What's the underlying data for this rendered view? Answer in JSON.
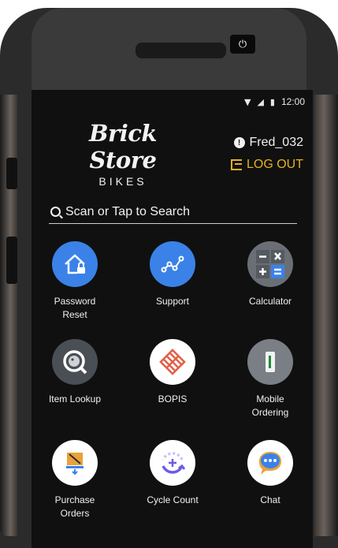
{
  "device": {
    "power_symbol": "⏻"
  },
  "status_bar": {
    "time": "12:00"
  },
  "logo": {
    "main": "Brick Store",
    "sub": "BIKES"
  },
  "user": {
    "name": "Fred_032",
    "logout_label": "LOG OUT"
  },
  "search": {
    "placeholder": "Scan or Tap to Search"
  },
  "apps": [
    {
      "id": "password-reset",
      "label": "Password\nReset",
      "icon": "house-lock-icon",
      "color": "#3a82e8"
    },
    {
      "id": "support",
      "label": "Support",
      "icon": "graph-icon",
      "color": "#3a82e8"
    },
    {
      "id": "calculator",
      "label": "Calculator",
      "icon": "calculator-icon",
      "color": "#6a6f76"
    },
    {
      "id": "item-lookup",
      "label": "Item Lookup",
      "icon": "lookup-icon",
      "color": "#4a4f55"
    },
    {
      "id": "bopis",
      "label": "BOPIS",
      "icon": "bopis-icon",
      "color": "#ffffff"
    },
    {
      "id": "mobile-ordering",
      "label": "Mobile\nOrdering",
      "icon": "phone-icon",
      "color": "#7a7f86"
    },
    {
      "id": "purchase-orders",
      "label": "Purchase\nOrders",
      "icon": "inbox-icon",
      "color": "#ffffff"
    },
    {
      "id": "cycle-count",
      "label": "Cycle Count",
      "icon": "cycle-icon",
      "color": "#ffffff"
    },
    {
      "id": "chat",
      "label": "Chat",
      "icon": "chat-icon",
      "color": "#ffffff"
    }
  ]
}
